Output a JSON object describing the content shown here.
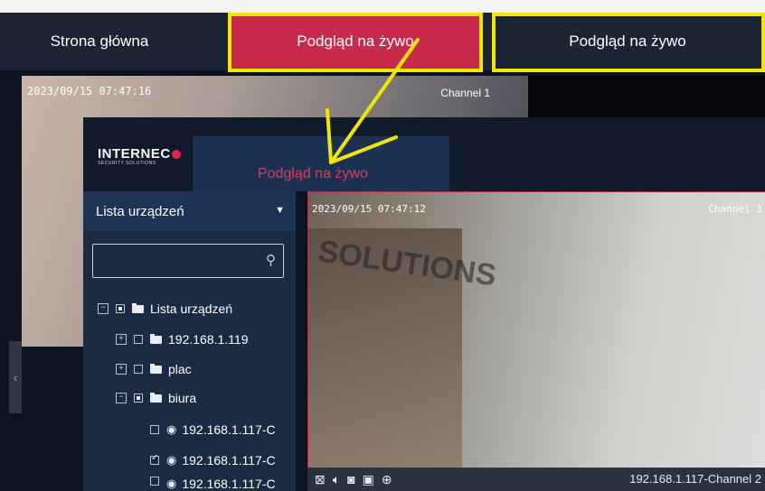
{
  "topbar": {
    "tabs": [
      {
        "label": "Strona główna"
      },
      {
        "label": "Podgląd na żywo"
      },
      {
        "label": "Podgląd na żywo"
      }
    ]
  },
  "outer_video": {
    "timestamp": "2023/09/15 07:47:16",
    "channel": "Channel 1"
  },
  "inner": {
    "logo": {
      "brand": "INTERNEC",
      "sub": "SECURITY SOLUTIONS"
    },
    "tab_label": "Podgląd na żywo",
    "device_select": {
      "label": "Lista urządzeń"
    },
    "search": {
      "placeholder": ""
    },
    "tree": [
      {
        "label": "Lista urządzeń"
      },
      {
        "label": "192.168.1.119"
      },
      {
        "label": "plac"
      },
      {
        "label": "biura"
      },
      {
        "label": "192.168.1.117-C"
      },
      {
        "label": "192.168.1.117-C"
      },
      {
        "label": "192.168.1.117-C"
      }
    ],
    "video": {
      "timestamp": "2023/09/15 07:47:12",
      "channel": "Channel 1",
      "watermark": "SOLUTIONS"
    },
    "toolbar": {
      "channel_label": "192.168.1.117-Channel 2"
    }
  },
  "colors": {
    "accent": "#c72a4a",
    "highlight": "#f2e600",
    "panel": "#1b2b42"
  }
}
